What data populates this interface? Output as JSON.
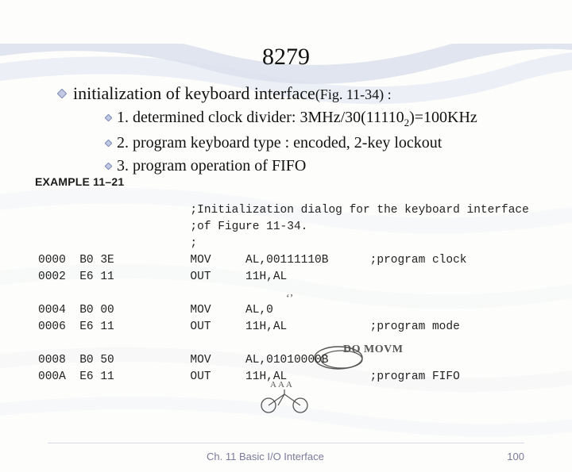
{
  "title": "8279",
  "headline": {
    "text": "initialization of keyboard interface",
    "fig": "(Fig. 11-34) :"
  },
  "bullets": [
    {
      "prefix": "1. determined clock divider: 3MHz/30(11110",
      "sub": "2",
      "suffix": ")=100KHz"
    },
    {
      "prefix": "2. program keyboard type : encoded, 2-key lockout",
      "sub": "",
      "suffix": ""
    },
    {
      "prefix": "3. program operation of FIFO",
      "sub": "",
      "suffix": ""
    }
  ],
  "example": {
    "label": "EXAMPLE 11–21",
    "comment_lines": [
      ";Initialization dialog for the keyboard interface",
      ";of Figure 11-34.",
      ";"
    ],
    "rows": [
      {
        "addr": "0000",
        "hex": "B0 3E",
        "mnem": "MOV",
        "args": "AL,00111110B",
        "comment": ";program clock"
      },
      {
        "addr": "0002",
        "hex": "E6 11",
        "mnem": "OUT",
        "args": "11H,AL",
        "comment": ""
      },
      {
        "addr": "",
        "hex": "",
        "mnem": "",
        "args": "",
        "comment": ""
      },
      {
        "addr": "0004",
        "hex": "B0 00",
        "mnem": "MOV",
        "args": "AL,0",
        "comment": ""
      },
      {
        "addr": "0006",
        "hex": "E6 11",
        "mnem": "OUT",
        "args": "11H,AL",
        "comment": ";program mode"
      },
      {
        "addr": "",
        "hex": "",
        "mnem": "",
        "args": "",
        "comment": ""
      },
      {
        "addr": "0008",
        "hex": "B0 50",
        "mnem": "MOV",
        "args": "AL,01010000B",
        "comment": ""
      },
      {
        "addr": "000A",
        "hex": "E6 11",
        "mnem": "OUT",
        "args": "11H,AL",
        "comment": ";program FIFO"
      }
    ]
  },
  "annotations": {
    "tickmark": "ʻʼ",
    "loop_label": "DO MOVM",
    "scribble_small": "AAA"
  },
  "footer": {
    "chapter": "Ch. 11 Basic I/O Interface",
    "page": "100"
  },
  "colors": {
    "bullet_border": "#7a88b5",
    "bullet_fill": "#c1cae2"
  }
}
